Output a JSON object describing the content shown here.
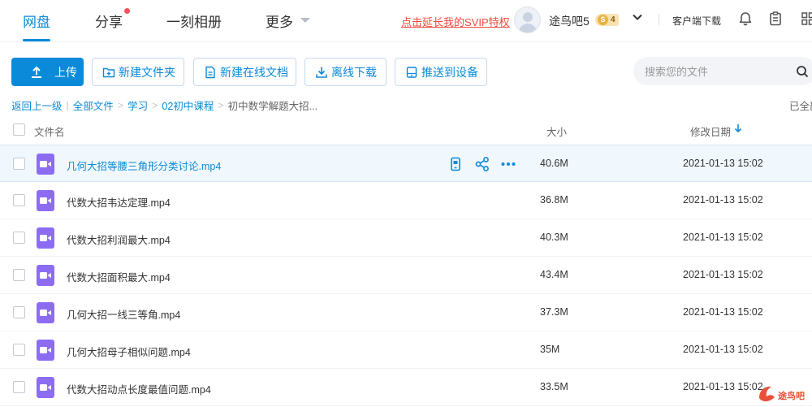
{
  "nav": {
    "tabs": [
      {
        "label": "网盘"
      },
      {
        "label": "分享"
      },
      {
        "label": "一刻相册"
      },
      {
        "label": "更多"
      }
    ],
    "svip_link": "点击延长我的SVIP特权",
    "username": "途鸟吧5",
    "vip_badge": "4",
    "vip_badge_s": "S",
    "client_download": "客户端下载"
  },
  "toolbar": {
    "upload": "上传",
    "new_folder": "新建文件夹",
    "new_doc": "新建在线文档",
    "offline_download": "离线下载",
    "push_device": "推送到设备",
    "search_placeholder": "搜索您的文件"
  },
  "breadcrumb": {
    "back": "返回上一级",
    "items": [
      "全部文件",
      "学习",
      "02初中课程"
    ],
    "current": "初中数学解题大招...",
    "right_text": "已全部"
  },
  "table": {
    "headers": {
      "name": "文件名",
      "size": "大小",
      "modified": "修改日期"
    },
    "rows": [
      {
        "name": "几何大招等腰三角形分类讨论.mp4",
        "size": "40.6M",
        "date": "2021-01-13 15:02"
      },
      {
        "name": "代数大招韦达定理.mp4",
        "size": "36.8M",
        "date": "2021-01-13 15:02"
      },
      {
        "name": "代数大招利润最大.mp4",
        "size": "40.3M",
        "date": "2021-01-13 15:02"
      },
      {
        "name": "代数大招面积最大.mp4",
        "size": "43.4M",
        "date": "2021-01-13 15:02"
      },
      {
        "name": "几何大招一线三等角.mp4",
        "size": "37.3M",
        "date": "2021-01-13 15:02"
      },
      {
        "name": "几何大招母子相似问题.mp4",
        "size": "35M",
        "date": "2021-01-13 15:02"
      },
      {
        "name": "代数大招动点长度最值问题.mp4",
        "size": "33.5M",
        "date": "2021-01-13 15:02"
      }
    ]
  },
  "watermark": "途鸟吧",
  "colors": {
    "accent": "#0a8ad8",
    "video_icon": "#8c6df2",
    "svip_red": "#f24a3d"
  }
}
